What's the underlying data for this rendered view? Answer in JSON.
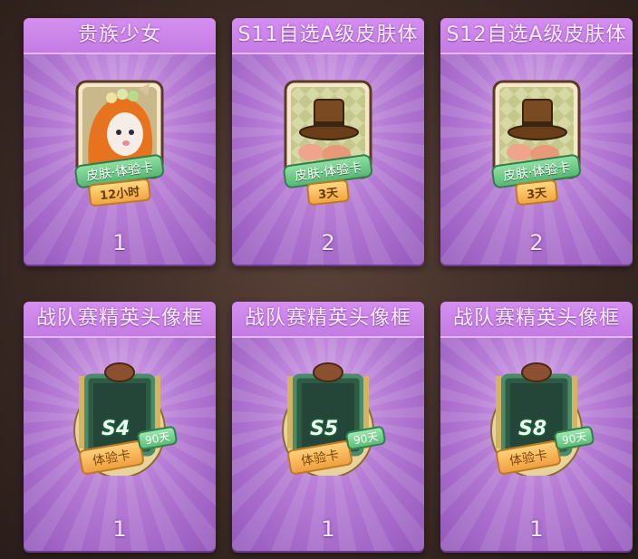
{
  "cards": [
    {
      "title": "贵族少女",
      "count": "1",
      "tag": "皮肤·体验卡",
      "duration": "12小时",
      "kind": "skin"
    },
    {
      "title": "S11自选A级皮肤体",
      "count": "2",
      "tag": "皮肤·体验卡",
      "duration": "3天",
      "kind": "skin"
    },
    {
      "title": "S12自选A级皮肤体",
      "count": "2",
      "tag": "皮肤·体验卡",
      "duration": "3天",
      "kind": "skin"
    },
    {
      "title": "战队赛精英头像框",
      "count": "1",
      "season": "S4",
      "tag": "体验卡",
      "duration": "90天",
      "kind": "frame"
    },
    {
      "title": "战队赛精英头像框",
      "count": "1",
      "season": "S5",
      "tag": "体验卡",
      "duration": "90天",
      "kind": "frame"
    },
    {
      "title": "战队赛精英头像框",
      "count": "1",
      "season": "S8",
      "tag": "体验卡",
      "duration": "90天",
      "kind": "frame"
    }
  ]
}
